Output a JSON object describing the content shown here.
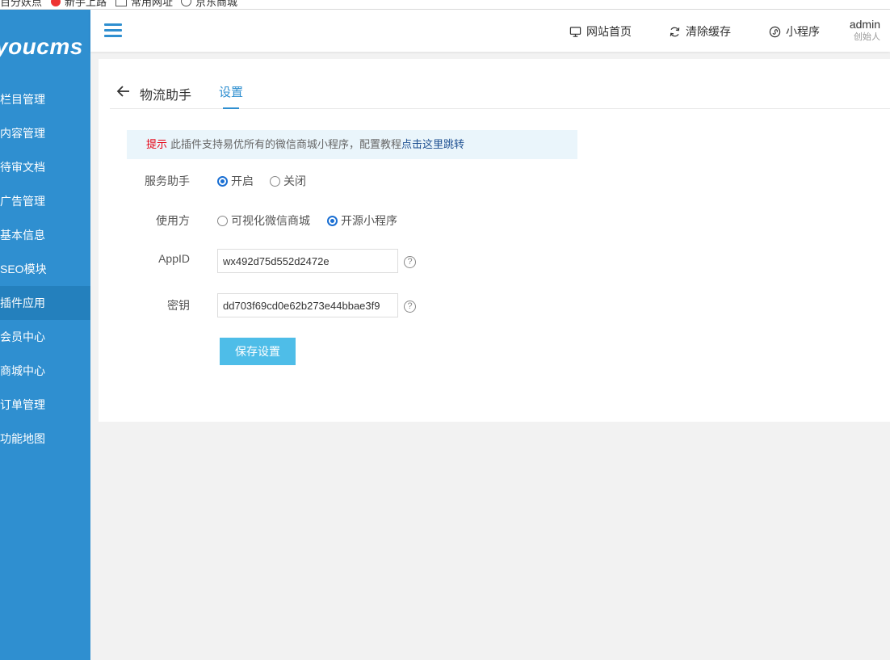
{
  "browser": {
    "bookmarks": [
      "百分妖点",
      "新手上路",
      "常用网址",
      "京东商城"
    ]
  },
  "sidebar": {
    "logo": "youcms",
    "items": [
      {
        "label": "栏目管理"
      },
      {
        "label": "内容管理"
      },
      {
        "label": "待审文档"
      },
      {
        "label": "广告管理"
      },
      {
        "label": "基本信息"
      },
      {
        "label": "SEO模块"
      },
      {
        "label": "插件应用"
      },
      {
        "label": "会员中心"
      },
      {
        "label": "商城中心"
      },
      {
        "label": "订单管理"
      },
      {
        "label": "功能地图"
      }
    ],
    "active_item": "插件应用",
    "bg_color": "#2f8fd0"
  },
  "header": {
    "site_home": "网站首页",
    "clear_cache": "清除缓存",
    "mini_program": "小程序",
    "user_name": "admin",
    "user_role": "创始人"
  },
  "page": {
    "back_icon": "arrow-left-icon",
    "plugin_title": "物流助手",
    "tab_settings": "设置"
  },
  "notice": {
    "tip_label": "提示",
    "text": "此插件支持易优所有的微信商城小程序，配置教程",
    "link_text": "点击这里跳转"
  },
  "form": {
    "service_label": "服务助手",
    "service_options": [
      "开启",
      "关闭"
    ],
    "service_selected": "开启",
    "user_label": "使用方",
    "user_options": [
      "可视化微信商城",
      "开源小程序"
    ],
    "user_selected": "开源小程序",
    "appid_label": "AppID",
    "appid_value": "wx492d75d552d2472e",
    "secret_label": "密钥",
    "secret_value": "dd703f69cd0e62b273e44bbae3f9",
    "help_glyph": "?",
    "save_label": "保存设置"
  },
  "colors": {
    "accent": "#2f8fd0",
    "save_button": "#4ebde8",
    "tip_red": "#e60012",
    "radio_checked": "#1a6fd3"
  }
}
